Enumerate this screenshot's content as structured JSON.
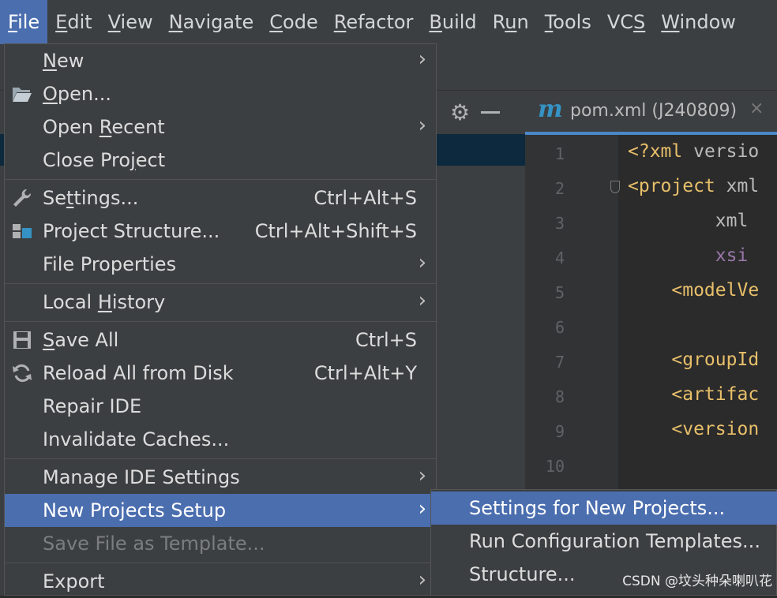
{
  "menubar": {
    "items": [
      {
        "pre": "",
        "u": "F",
        "post": "ile"
      },
      {
        "pre": "",
        "u": "E",
        "post": "dit"
      },
      {
        "pre": "",
        "u": "V",
        "post": "iew"
      },
      {
        "pre": "",
        "u": "N",
        "post": "avigate"
      },
      {
        "pre": "",
        "u": "C",
        "post": "ode"
      },
      {
        "pre": "",
        "u": "R",
        "post": "efactor"
      },
      {
        "pre": "",
        "u": "B",
        "post": "uild"
      },
      {
        "pre": "R",
        "u": "u",
        "post": "n"
      },
      {
        "pre": "",
        "u": "T",
        "post": "ools"
      },
      {
        "pre": "VC",
        "u": "S",
        "post": ""
      },
      {
        "pre": "",
        "u": "W",
        "post": "indow"
      }
    ]
  },
  "file_menu": {
    "new": {
      "pre": "",
      "u": "N",
      "post": "ew"
    },
    "open": {
      "pre": "",
      "u": "O",
      "post": "pen..."
    },
    "open_recent": {
      "pre": "Open ",
      "u": "R",
      "post": "ecent"
    },
    "close_project": {
      "pre": "Close Pro",
      "u": "j",
      "post": "ect"
    },
    "settings": {
      "pre": "Se",
      "u": "t",
      "post": "tings...",
      "shortcut": "Ctrl+Alt+S"
    },
    "project_structure": {
      "label": "Project Structure...",
      "shortcut": "Ctrl+Alt+Shift+S"
    },
    "file_properties": {
      "label": "File Properties"
    },
    "local_history": {
      "pre": "Local ",
      "u": "H",
      "post": "istory"
    },
    "save_all": {
      "pre": "",
      "u": "S",
      "post": "ave All",
      "shortcut": "Ctrl+S"
    },
    "reload": {
      "label": "Reload All from Disk",
      "shortcut": "Ctrl+Alt+Y"
    },
    "repair_ide": {
      "label": "Repair IDE"
    },
    "invalidate": {
      "label": "Invalidate Caches..."
    },
    "manage_ide": {
      "label": "Manage IDE Settings"
    },
    "new_projects_setup": {
      "label": "New Projects Setup"
    },
    "save_template": {
      "label": "Save File as Template..."
    },
    "export": {
      "label": "Export"
    }
  },
  "submenu": {
    "items": [
      "Settings for New Projects...",
      "Run Configuration Templates...",
      "Structure..."
    ]
  },
  "editor": {
    "tab_icon": "m",
    "tab_title": "pom.xml (J240809)",
    "tab_close": "×",
    "line_numbers": [
      "1",
      "2",
      "3",
      "4",
      "5",
      "6",
      "7",
      "8",
      "9",
      "10"
    ],
    "code": [
      {
        "a": "<?xml ",
        "b": "versio"
      },
      {
        "a": "<project ",
        "b": "xml"
      },
      {
        "a": "        ",
        "b": "xml"
      },
      {
        "a": "        ",
        "b": "xsi"
      },
      {
        "a": "    <modelVe",
        "b": ""
      },
      {
        "a": "",
        "b": ""
      },
      {
        "a": "    <groupId",
        "b": ""
      },
      {
        "a": "    <artifac",
        "b": ""
      },
      {
        "a": "    <version",
        "b": ""
      },
      {
        "a": "",
        "b": ""
      }
    ]
  },
  "colors": {
    "menu_bg": "#3c3f41",
    "highlight": "#4b6eaf",
    "xml_tag": "#e8bf6a",
    "xml_attr": "#bababa",
    "xml_ns": "#9876aa"
  },
  "icons": {
    "folder": "folder-open-icon",
    "wrench": "wrench-icon",
    "structure": "project-structure-icon",
    "save": "floppy-disk-icon",
    "reload": "reload-icon",
    "gear": "gear-icon",
    "chevron": "chevron-right-icon"
  },
  "watermark": "CSDN @坟头种朵喇叭花"
}
